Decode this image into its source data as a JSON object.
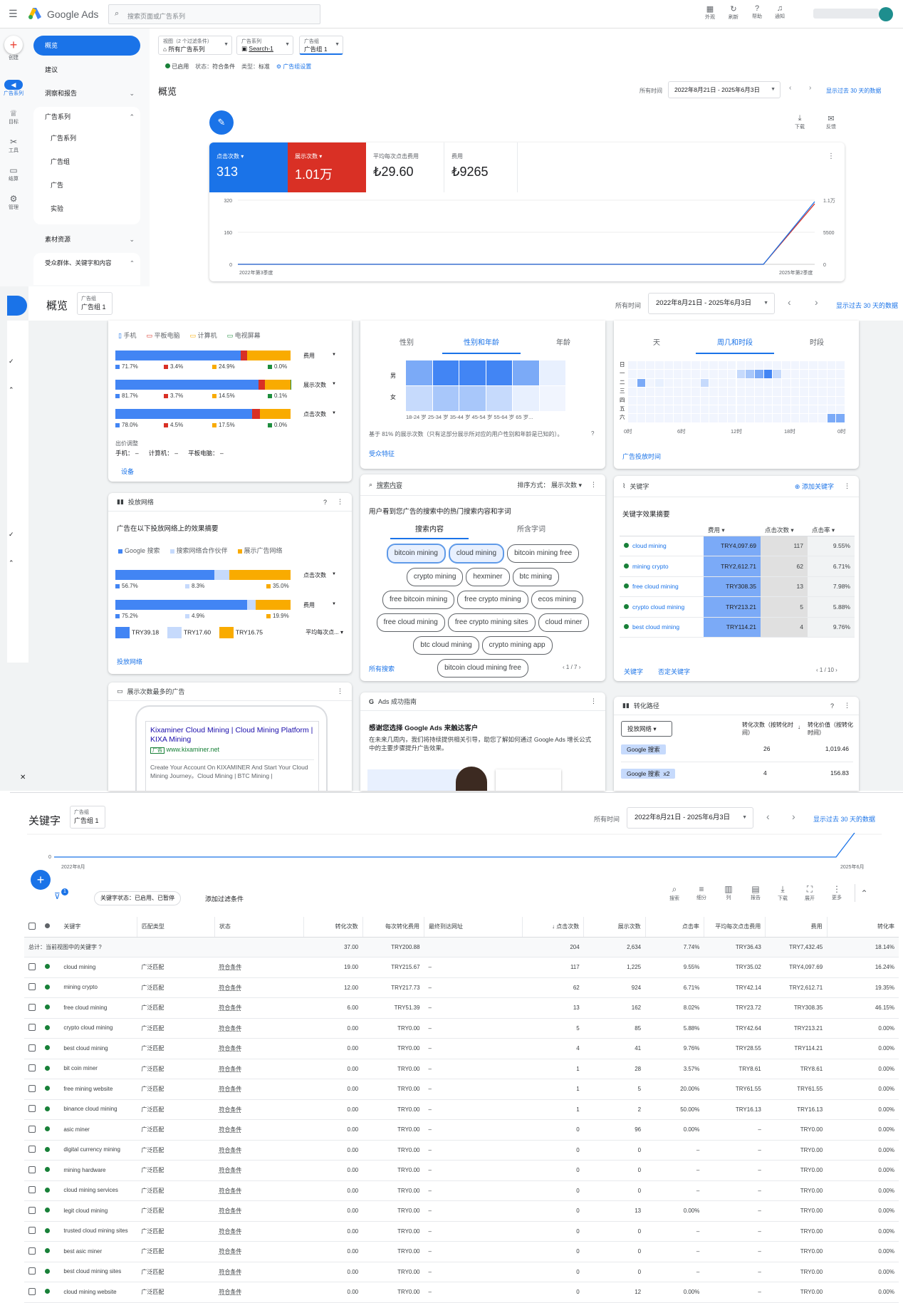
{
  "app": {
    "brand": "Google Ads",
    "search_placeholder": "搜索页面或广告系列"
  },
  "topbar": {
    "appearance": "外观",
    "refresh": "刷新",
    "help": "帮助",
    "notify": "通知"
  },
  "leftrail": {
    "create": "创建",
    "campaigns": "广告系列",
    "goals": "目标",
    "tools": "工具",
    "billing": "结算",
    "admin": "管理"
  },
  "nav": {
    "overview": "概览",
    "recommendations": "建议",
    "insights": "洞察和报告",
    "campaigns_group": "广告系列",
    "campaigns": "广告系列",
    "adgroups": "广告组",
    "ads": "广告",
    "experiments": "实验",
    "assets": "素材资源",
    "audiences": "受众群体、关键字和内容"
  },
  "scope": {
    "view_label": "视图（2 个过滤条件）",
    "view_value": "所有广告系列",
    "campaign_label": "广告系列",
    "campaign_value": "Search-1",
    "adgroup_label": "广告组",
    "adgroup_value": "广告组 1",
    "status_enabled": "已启用",
    "status": "状态：",
    "status_value": "符合条件",
    "type": "类型：",
    "type_value": "标准",
    "settings": "广告组设置"
  },
  "overview": {
    "title": "概览",
    "time_label": "所有时间",
    "date_range": "2022年8月21日 - 2025年6月3日",
    "show30": "显示过去 30 天的数据",
    "download": "下载",
    "feedback": "反馈"
  },
  "metrics": [
    {
      "label": "点击次数",
      "value": "313"
    },
    {
      "label": "展示次数",
      "value": "1.01万"
    },
    {
      "label": "平均每次点击费用",
      "value": "₺29.60"
    },
    {
      "label": "费用",
      "value": "₺9265"
    }
  ],
  "chart_data": {
    "type": "line",
    "x": [
      "2022年第3季度",
      "2025年第2季度"
    ],
    "series": [
      {
        "name": "点击次数",
        "values": [
          0,
          0,
          0,
          0,
          0,
          310
        ]
      },
      {
        "name": "展示次数",
        "values": [
          0,
          0,
          0,
          0,
          0,
          10100
        ]
      }
    ],
    "y_left_ticks": [
      "320",
      "160",
      "0"
    ],
    "y_right_ticks": [
      "1.1万",
      "5500",
      "0"
    ]
  },
  "sec2": {
    "title": "概览",
    "adgroup_label": "广告组",
    "adgroup_value": "广告组 1"
  },
  "devices": {
    "legend": [
      "手机",
      "平板电脑",
      "计算机",
      "电视屏幕"
    ],
    "rows": [
      {
        "metric": "费用",
        "vals": [
          "71.7%",
          "3.4%",
          "24.9%",
          "0.0%"
        ],
        "p": [
          71.7,
          3.4,
          24.9,
          0
        ]
      },
      {
        "metric": "展示次数",
        "vals": [
          "81.7%",
          "3.7%",
          "14.5%",
          "0.1%"
        ],
        "p": [
          81.7,
          3.7,
          14.5,
          0.1
        ]
      },
      {
        "metric": "点击次数",
        "vals": [
          "78.0%",
          "4.5%",
          "17.5%",
          "0.0%"
        ],
        "p": [
          78,
          4.5,
          17.5,
          0
        ]
      }
    ],
    "bid_adj": "出价调整",
    "bid_phone": "手机：",
    "bid_pc": "计算机：",
    "bid_tablet": "平板电脑：",
    "dash": "–",
    "link": "设备"
  },
  "demo": {
    "tabs": [
      "性别",
      "性别和年龄",
      "年龄"
    ],
    "male": "男",
    "female": "女",
    "ages": "18-24 岁 25-34 岁 35-44 岁 45-54 岁 55-64 岁 65 岁...",
    "note": "基于 81% 的展示次数（只有这部分展示所对应的用户性别和年龄是已知的）。",
    "link": "受众特征"
  },
  "schedule": {
    "tabs": [
      "天",
      "周几和时段",
      "时段"
    ],
    "days": [
      "日",
      "一",
      "二",
      "三",
      "四",
      "五",
      "六"
    ],
    "hours": [
      "0时",
      "6时",
      "12时",
      "18时",
      "0时"
    ],
    "link": "广告投放时间"
  },
  "network": {
    "title": "投放网络",
    "heading": "广告在以下投放网络上的效果摘要",
    "legend": [
      "Google 搜索",
      "搜索网络合作伙伴",
      "展示广告网络"
    ],
    "rows": [
      {
        "metric": "点击次数",
        "vals": [
          "56.7%",
          "8.3%",
          "35.0%"
        ],
        "p": [
          56.7,
          8.3,
          35
        ]
      },
      {
        "metric": "费用",
        "vals": [
          "75.2%",
          "4.9%",
          "19.9%"
        ],
        "p": [
          75.2,
          4.9,
          19.9
        ]
      }
    ],
    "cpc": [
      "TRY39.18",
      "TRY17.60",
      "TRY16.75"
    ],
    "cpc_metric": "平均每次点...",
    "link": "投放网络"
  },
  "searchterms": {
    "title": "搜索内容",
    "sort": "排序方式：",
    "sort_value": "展示次数",
    "heading": "用户看到您广告的搜索中的热门搜索内容和字词",
    "tabs": [
      "搜索内容",
      "所含字词"
    ],
    "terms": [
      "bitcoin mining",
      "cloud mining",
      "bitcoin mining free",
      "crypto mining",
      "hexminer",
      "btc mining",
      "free bitcoin mining",
      "free crypto mining",
      "ecos mining",
      "free cloud mining",
      "free crypto mining sites",
      "cloud miner",
      "btc cloud mining",
      "crypto mining app",
      "bitcoin cloud mining free"
    ],
    "link": "所有搜索",
    "page": "1 / 7"
  },
  "keywords_card": {
    "title": "关键字",
    "add": "添加关键字",
    "heading": "关键字效果摘要",
    "cols": [
      "费用",
      "点击次数",
      "点击率"
    ],
    "rows": [
      [
        "cloud mining",
        "TRY4,097.69",
        "117",
        "9.55%"
      ],
      [
        "mining crypto",
        "TRY2,612.71",
        "62",
        "6.71%"
      ],
      [
        "free cloud mining",
        "TRY308.35",
        "13",
        "7.98%"
      ],
      [
        "crypto cloud mining",
        "TRY213.21",
        "5",
        "5.88%"
      ],
      [
        "best cloud mining",
        "TRY114.21",
        "4",
        "9.76%"
      ]
    ],
    "link1": "关键字",
    "link2": "否定关键字",
    "page": "1 / 10"
  },
  "topad": {
    "title": "展示次数最多的广告",
    "headline": "Kixaminer Cloud Mining | Cloud Mining Platform | KIXA Mining",
    "badge": "广告",
    "url": "www.kixaminer.net",
    "desc": "Create Your Account On KIXAMINER And Start Your Cloud Mining Journey。Cloud Mining | BTC Mining |"
  },
  "guide": {
    "title": "Ads 成功指南",
    "heading": "感谢您选择 Google Ads 来触达客户",
    "body": "在未来几周内，我们将持续提供相关引导，助您了解如何通过 Google Ads 增长公式中的主要步骤提升广告效果。"
  },
  "convpath": {
    "title": "转化路径",
    "filter": "投放网络",
    "col1": "转化次数（按转化时间）",
    "col2": "转化价值（按转化时间）",
    "rows": [
      [
        "Google 搜索",
        "26",
        "1,019.46"
      ],
      [
        "Google 搜索  x2",
        "4",
        "156.83"
      ]
    ]
  },
  "sec3": {
    "title": "关键字",
    "adgroup_label": "广告组",
    "adgroup_value": "广告组 1",
    "time_label": "所有时间",
    "date_range": "2022年8月21日 - 2025年6月3日",
    "show30": "显示过去 30 天的数据",
    "x_start": "2022年8月",
    "x_end": "2025年6月",
    "y0": "0",
    "filter_chip": "关键字状态：已启用、已暂停",
    "add_filter": "添加过滤条件",
    "filter_count": "1",
    "tools": [
      "搜索",
      "细分",
      "列",
      "报告",
      "下载",
      "展开",
      "更多"
    ]
  },
  "table": {
    "headers": [
      "关键字",
      "匹配类型",
      "状态",
      "转化次数",
      "每次转化费用",
      "最终到达网址",
      "点击次数",
      "展示次数",
      "点击率",
      "平均每次点击费用",
      "费用",
      "转化率"
    ],
    "total": [
      "总计：当前视图中的关键字",
      "",
      "",
      "37.00",
      "TRY200.88",
      "",
      "204",
      "2,634",
      "7.74%",
      "TRY36.43",
      "TRY7,432.45",
      "18.14%"
    ],
    "rows": [
      [
        "cloud mining",
        "广泛匹配",
        "符合条件",
        "19.00",
        "TRY215.67",
        "–",
        "117",
        "1,225",
        "9.55%",
        "TRY35.02",
        "TRY4,097.69",
        "16.24%"
      ],
      [
        "mining crypto",
        "广泛匹配",
        "符合条件",
        "12.00",
        "TRY217.73",
        "–",
        "62",
        "924",
        "6.71%",
        "TRY42.14",
        "TRY2,612.71",
        "19.35%"
      ],
      [
        "free cloud mining",
        "广泛匹配",
        "符合条件",
        "6.00",
        "TRY51.39",
        "–",
        "13",
        "162",
        "8.02%",
        "TRY23.72",
        "TRY308.35",
        "46.15%"
      ],
      [
        "crypto cloud mining",
        "广泛匹配",
        "符合条件",
        "0.00",
        "TRY0.00",
        "–",
        "5",
        "85",
        "5.88%",
        "TRY42.64",
        "TRY213.21",
        "0.00%"
      ],
      [
        "best cloud mining",
        "广泛匹配",
        "符合条件",
        "0.00",
        "TRY0.00",
        "–",
        "4",
        "41",
        "9.76%",
        "TRY28.55",
        "TRY114.21",
        "0.00%"
      ],
      [
        "bit coin miner",
        "广泛匹配",
        "符合条件",
        "0.00",
        "TRY0.00",
        "–",
        "1",
        "28",
        "3.57%",
        "TRY8.61",
        "TRY8.61",
        "0.00%"
      ],
      [
        "free mining website",
        "广泛匹配",
        "符合条件",
        "0.00",
        "TRY0.00",
        "–",
        "1",
        "5",
        "20.00%",
        "TRY61.55",
        "TRY61.55",
        "0.00%"
      ],
      [
        "binance cloud mining",
        "广泛匹配",
        "符合条件",
        "0.00",
        "TRY0.00",
        "–",
        "1",
        "2",
        "50.00%",
        "TRY16.13",
        "TRY16.13",
        "0.00%"
      ],
      [
        "asic miner",
        "广泛匹配",
        "符合条件",
        "0.00",
        "TRY0.00",
        "–",
        "0",
        "96",
        "0.00%",
        "–",
        "TRY0.00",
        "0.00%"
      ],
      [
        "digital currency mining",
        "广泛匹配",
        "符合条件",
        "0.00",
        "TRY0.00",
        "–",
        "0",
        "0",
        "–",
        "–",
        "TRY0.00",
        "0.00%"
      ],
      [
        "mining hardware",
        "广泛匹配",
        "符合条件",
        "0.00",
        "TRY0.00",
        "–",
        "0",
        "0",
        "–",
        "–",
        "TRY0.00",
        "0.00%"
      ],
      [
        "cloud mining services",
        "广泛匹配",
        "符合条件",
        "0.00",
        "TRY0.00",
        "–",
        "0",
        "0",
        "–",
        "–",
        "TRY0.00",
        "0.00%"
      ],
      [
        "legit cloud mining",
        "广泛匹配",
        "符合条件",
        "0.00",
        "TRY0.00",
        "–",
        "0",
        "13",
        "0.00%",
        "–",
        "TRY0.00",
        "0.00%"
      ],
      [
        "trusted cloud mining sites",
        "广泛匹配",
        "符合条件",
        "0.00",
        "TRY0.00",
        "–",
        "0",
        "0",
        "–",
        "–",
        "TRY0.00",
        "0.00%"
      ],
      [
        "best asic miner",
        "广泛匹配",
        "符合条件",
        "0.00",
        "TRY0.00",
        "–",
        "0",
        "0",
        "–",
        "–",
        "TRY0.00",
        "0.00%"
      ],
      [
        "best cloud mining sites",
        "广泛匹配",
        "符合条件",
        "0.00",
        "TRY0.00",
        "–",
        "0",
        "0",
        "–",
        "–",
        "TRY0.00",
        "0.00%"
      ],
      [
        "cloud mining website",
        "广泛匹配",
        "符合条件",
        "0.00",
        "TRY0.00",
        "–",
        "0",
        "12",
        "0.00%",
        "–",
        "TRY0.00",
        "0.00%"
      ]
    ]
  }
}
